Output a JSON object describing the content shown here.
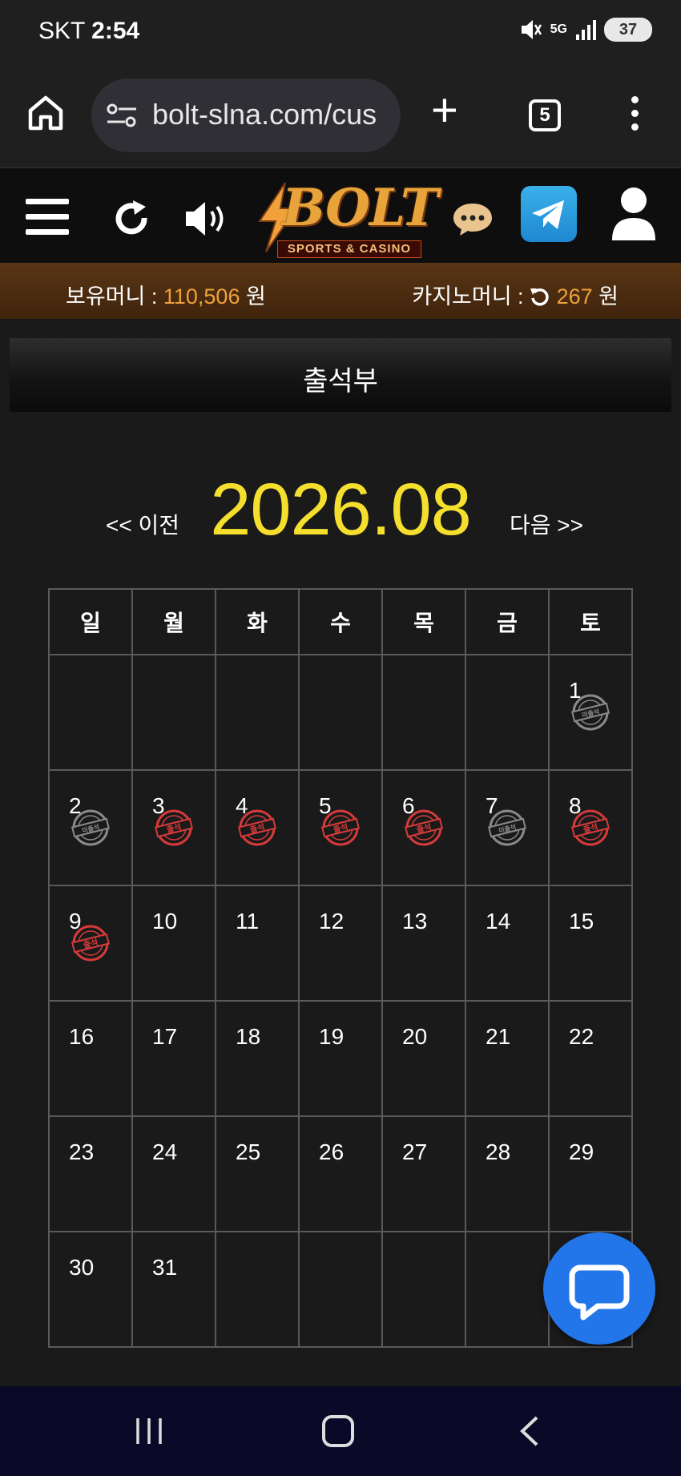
{
  "status_bar": {
    "carrier": "SKT",
    "time": "2:54",
    "network": "5G",
    "battery": "37"
  },
  "browser": {
    "url": "bolt-slna.com/cus",
    "tab_count": "5"
  },
  "header": {
    "logo_text": "BOLT",
    "logo_subtitle": "SPORTS & CASINO"
  },
  "money": {
    "holding_label": "보유머니 : ",
    "holding_value": "110,506",
    "holding_unit": " 원",
    "casino_label": "카지노머니 : ",
    "casino_value": "267",
    "casino_unit": " 원"
  },
  "page": {
    "title": "출석부",
    "prev_label": "<< 이전",
    "next_label": "다음 >>",
    "month": "2026.08"
  },
  "calendar": {
    "weekdays": [
      "일",
      "월",
      "화",
      "수",
      "목",
      "금",
      "토"
    ],
    "stamp_attended_label": "출석",
    "stamp_missed_label": "미출석",
    "weeks": [
      [
        {
          "day": "",
          "stamp": ""
        },
        {
          "day": "",
          "stamp": ""
        },
        {
          "day": "",
          "stamp": ""
        },
        {
          "day": "",
          "stamp": ""
        },
        {
          "day": "",
          "stamp": ""
        },
        {
          "day": "",
          "stamp": ""
        },
        {
          "day": "1",
          "stamp": "missed"
        }
      ],
      [
        {
          "day": "2",
          "stamp": "missed"
        },
        {
          "day": "3",
          "stamp": "attended"
        },
        {
          "day": "4",
          "stamp": "attended"
        },
        {
          "day": "5",
          "stamp": "attended"
        },
        {
          "day": "6",
          "stamp": "attended"
        },
        {
          "day": "7",
          "stamp": "missed"
        },
        {
          "day": "8",
          "stamp": "attended"
        }
      ],
      [
        {
          "day": "9",
          "stamp": "attended"
        },
        {
          "day": "10",
          "stamp": ""
        },
        {
          "day": "11",
          "stamp": ""
        },
        {
          "day": "12",
          "stamp": ""
        },
        {
          "day": "13",
          "stamp": ""
        },
        {
          "day": "14",
          "stamp": ""
        },
        {
          "day": "15",
          "stamp": ""
        }
      ],
      [
        {
          "day": "16",
          "stamp": ""
        },
        {
          "day": "17",
          "stamp": ""
        },
        {
          "day": "18",
          "stamp": ""
        },
        {
          "day": "19",
          "stamp": ""
        },
        {
          "day": "20",
          "stamp": ""
        },
        {
          "day": "21",
          "stamp": ""
        },
        {
          "day": "22",
          "stamp": ""
        }
      ],
      [
        {
          "day": "23",
          "stamp": ""
        },
        {
          "day": "24",
          "stamp": ""
        },
        {
          "day": "25",
          "stamp": ""
        },
        {
          "day": "26",
          "stamp": ""
        },
        {
          "day": "27",
          "stamp": ""
        },
        {
          "day": "28",
          "stamp": ""
        },
        {
          "day": "29",
          "stamp": ""
        }
      ],
      [
        {
          "day": "30",
          "stamp": ""
        },
        {
          "day": "31",
          "stamp": ""
        },
        {
          "day": "",
          "stamp": ""
        },
        {
          "day": "",
          "stamp": ""
        },
        {
          "day": "",
          "stamp": ""
        },
        {
          "day": "",
          "stamp": ""
        },
        {
          "day": "",
          "stamp": ""
        }
      ]
    ]
  },
  "colors": {
    "month_accent": "#f5df2e",
    "money_value": "#f0a23a",
    "stamp_attended": "#d63a3a",
    "stamp_missed": "#8a8a8a",
    "fab": "#2276ea"
  },
  "icons": {
    "status": [
      "mute-vibrate-icon",
      "5g-icon",
      "signal-icon",
      "battery-charging-icon"
    ],
    "browser": [
      "home-icon",
      "site-settings-icon",
      "new-tab-icon",
      "tab-switcher-icon",
      "more-menu-icon"
    ],
    "header": [
      "hamburger-menu-icon",
      "refresh-icon",
      "speaker-icon",
      "chat-bubble-icon",
      "telegram-icon",
      "user-icon"
    ],
    "fab": "live-chat-icon",
    "nav": [
      "recent-apps-icon",
      "home-button-icon",
      "back-icon"
    ]
  }
}
